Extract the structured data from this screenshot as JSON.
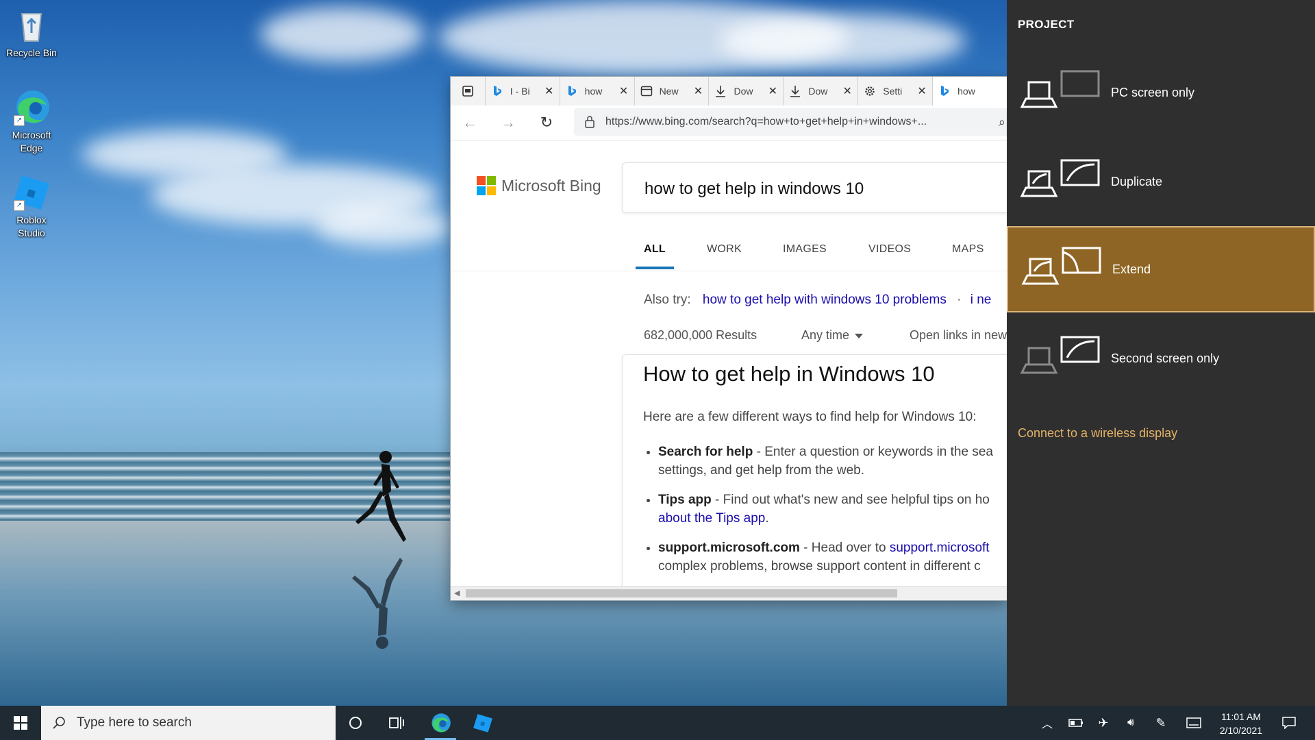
{
  "desktop": {
    "icons": [
      {
        "label": "Recycle Bin",
        "icon": "recycle-bin-icon"
      },
      {
        "label": "Microsoft Edge",
        "icon": "edge-icon"
      },
      {
        "label": "Roblox Studio",
        "icon": "roblox-studio-icon"
      }
    ]
  },
  "browser": {
    "tabs": [
      {
        "title": "I - Bi",
        "icon": "bing-icon"
      },
      {
        "title": "how",
        "icon": "bing-icon"
      },
      {
        "title": "New",
        "icon": "new-tab-icon"
      },
      {
        "title": "Dow",
        "icon": "download-icon"
      },
      {
        "title": "Dow",
        "icon": "download-icon"
      },
      {
        "title": "Setti",
        "icon": "settings-icon"
      },
      {
        "title": "how",
        "icon": "bing-icon"
      }
    ],
    "url": "https://www.bing.com/search?q=how+to+get+help+in+windows+..."
  },
  "bing": {
    "brand": "Microsoft Bing",
    "query": "how to get help in windows 10",
    "scopes": [
      "ALL",
      "WORK",
      "IMAGES",
      "VIDEOS",
      "MAPS"
    ],
    "also_try_label": "Also try:",
    "also_try_link": "how to get help with windows 10 problems",
    "also_try_sep": "·",
    "also_try_link2": "i ne",
    "results_count": "682,000,000 Results",
    "any_time": "Any time",
    "open_links": "Open links in new",
    "answer": {
      "title": "How to get help in Windows 10",
      "intro": "Here are a few different ways to find help for Windows 10:",
      "items": [
        {
          "bold": "Search for help",
          "text1": " - Enter a question or keywords in the sea",
          "text2": "settings, and get help from the web."
        },
        {
          "bold": "Tips app",
          "text1": " - Find out what's new and see helpful tips on ho",
          "link": "about the Tips app",
          "tail": "."
        },
        {
          "bold": "support.microsoft.com",
          "text1": " - Head over to ",
          "link": "support.microsoft",
          "text2": "complex problems, browse support content in different c"
        }
      ]
    }
  },
  "project": {
    "title": "PROJECT",
    "options": [
      "PC screen only",
      "Duplicate",
      "Extend",
      "Second screen only"
    ],
    "selected": "Extend",
    "wireless": "Connect to a wireless display"
  },
  "taskbar": {
    "search_placeholder": "Type here to search",
    "time": "11:01 AM",
    "date": "2/10/2021"
  },
  "colors": {
    "project_bg": "#2f2f2f",
    "project_selected": "#8e6524",
    "accent_link": "#e4b36a",
    "taskbar": "#1f2a33"
  }
}
